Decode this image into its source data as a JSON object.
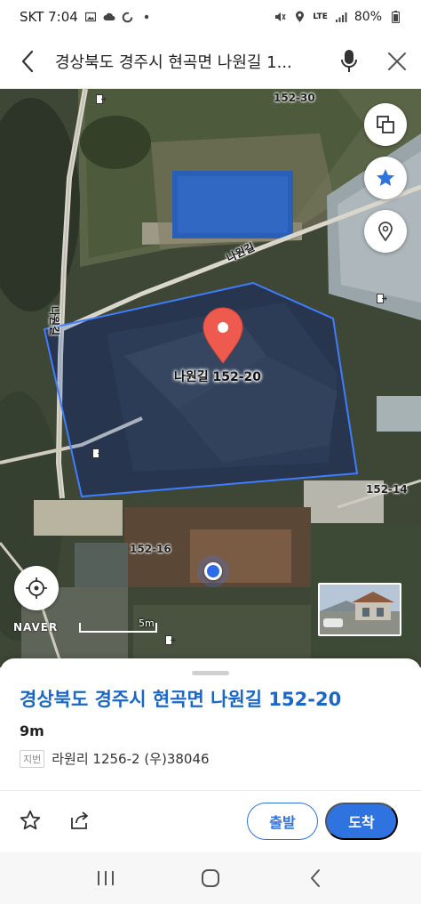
{
  "status_bar": {
    "carrier_time": "SKT 7:04",
    "network": "LTE",
    "battery": "80%"
  },
  "search": {
    "query": "경상북도 경주시 현곡면 나원길 1..."
  },
  "map": {
    "labels": {
      "l_152_30": "152-30",
      "l_152_14": "152-14",
      "l_152_16": "152-16",
      "road_naweon": "나원길",
      "road_naweon_v": "나원길"
    },
    "pin_label": "나원길 152-20",
    "scale_label": "5m",
    "brand": "NAVER"
  },
  "sheet": {
    "title": "경상북도 경주시 현곡면 나원길 152-20",
    "distance": "9m",
    "jibun_badge": "지번",
    "jibun_address": "라원리 1256-2 (우)38046",
    "depart_label": "출발",
    "arrive_label": "도착"
  },
  "colors": {
    "accent": "#2f73e0",
    "title_blue": "#1b67c8",
    "pin": "#ef5a4f",
    "boundary": "#3f7dff"
  },
  "icons": [
    "back-arrow-icon",
    "mic-icon",
    "close-icon",
    "layers-icon",
    "star-icon",
    "location-pin-icon",
    "crosshair-icon",
    "share-icon",
    "recent-apps-icon",
    "home-icon",
    "back-nav-icon"
  ]
}
